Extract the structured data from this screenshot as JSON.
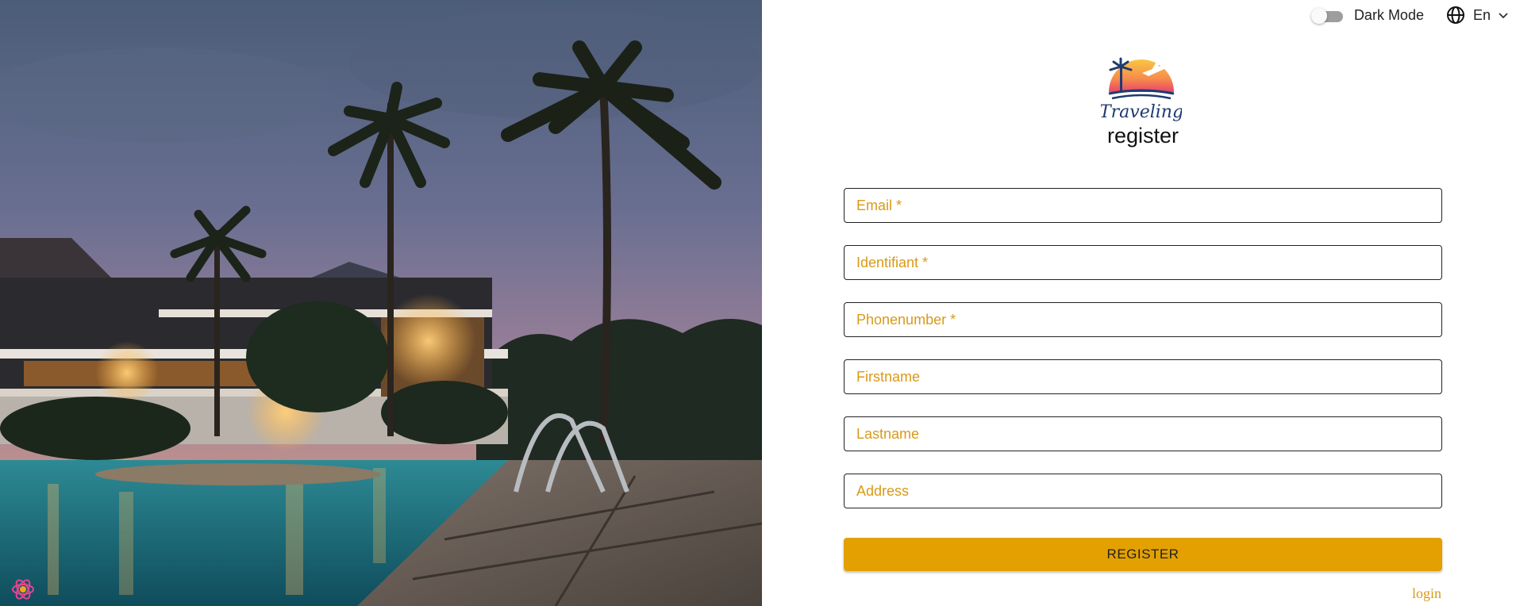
{
  "topbar": {
    "dark_mode_label": "Dark Mode",
    "dark_mode_on": false,
    "language_code": "En"
  },
  "brand": {
    "logo_text": "Traveling"
  },
  "form": {
    "title": "register",
    "fields": [
      {
        "label": "Email *"
      },
      {
        "label": "Identifiant *"
      },
      {
        "label": "Phonenumber *"
      },
      {
        "label": "Firstname"
      },
      {
        "label": "Lastname"
      },
      {
        "label": "Address"
      }
    ],
    "submit_label": "REGISTER",
    "login_link": "login"
  },
  "colors": {
    "accent": "#e3a000",
    "field_label": "#d99a17",
    "border": "#222222"
  },
  "icons": [
    "globe-icon",
    "chevron-down-icon",
    "app-badge-icon",
    "logo-palm-plane"
  ]
}
